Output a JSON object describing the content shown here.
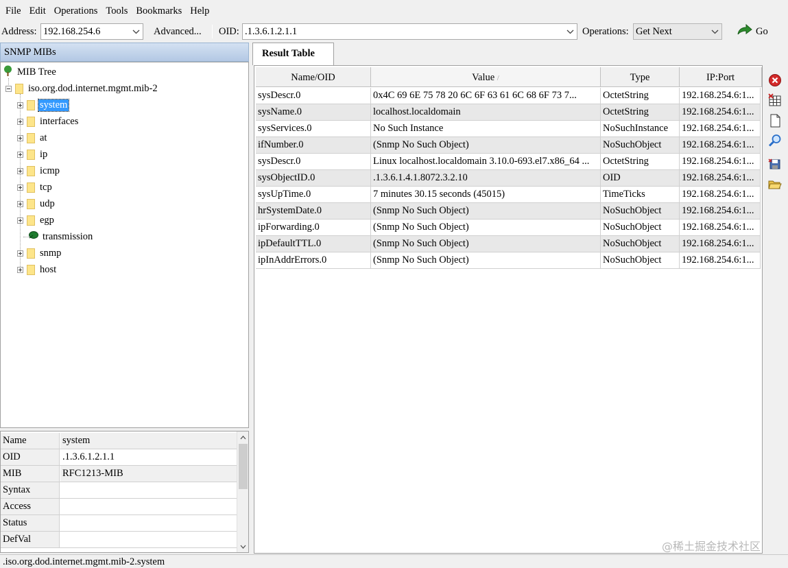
{
  "menu": [
    "File",
    "Edit",
    "Operations",
    "Tools",
    "Bookmarks",
    "Help"
  ],
  "toolbar": {
    "address_label": "Address:",
    "address_value": "192.168.254.6",
    "advanced_label": "Advanced...",
    "oid_label": "OID:",
    "oid_value": ".1.3.6.1.2.1.1",
    "operations_label": "Operations:",
    "operations_value": "Get Next",
    "go_label": "Go"
  },
  "left_panel": {
    "title": "SNMP MIBs",
    "tree": {
      "root": "MIB Tree",
      "branch": "iso.org.dod.internet.mgmt.mib-2",
      "children": [
        "system",
        "interfaces",
        "at",
        "ip",
        "icmp",
        "tcp",
        "udp",
        "egp",
        "transmission",
        "snmp",
        "host"
      ],
      "selected": "system"
    },
    "properties": [
      {
        "key": "Name",
        "value": "system"
      },
      {
        "key": "OID",
        "value": ".1.3.6.1.2.1.1"
      },
      {
        "key": "MIB",
        "value": "RFC1213-MIB"
      },
      {
        "key": "Syntax",
        "value": ""
      },
      {
        "key": "Access",
        "value": ""
      },
      {
        "key": "Status",
        "value": ""
      },
      {
        "key": "DefVal",
        "value": ""
      }
    ]
  },
  "result": {
    "tab_label": "Result Table",
    "columns": [
      "Name/OID",
      "Value",
      "Type",
      "IP:Port"
    ],
    "sort_indicator": "/",
    "rows": [
      {
        "name": "sysDescr.0",
        "value": "0x4C 69 6E 75 78 20 6C 6F 63 61 6C 68 6F 73 7...",
        "type": "OctetString",
        "ip": "192.168.254.6:1..."
      },
      {
        "name": "sysName.0",
        "value": "localhost.localdomain",
        "type": "OctetString",
        "ip": "192.168.254.6:1..."
      },
      {
        "name": "sysServices.0",
        "value": "No Such Instance",
        "type": "NoSuchInstance",
        "ip": "192.168.254.6:1..."
      },
      {
        "name": "ifNumber.0",
        "value": "(Snmp No Such Object)",
        "type": "NoSuchObject",
        "ip": "192.168.254.6:1..."
      },
      {
        "name": "sysDescr.0",
        "value": "Linux localhost.localdomain 3.10.0-693.el7.x86_64 ...",
        "type": "OctetString",
        "ip": "192.168.254.6:1..."
      },
      {
        "name": "sysObjectID.0",
        "value": ".1.3.6.1.4.1.8072.3.2.10",
        "type": "OID",
        "ip": "192.168.254.6:1..."
      },
      {
        "name": "sysUpTime.0",
        "value": "7 minutes 30.15 seconds (45015)",
        "type": "TimeTicks",
        "ip": "192.168.254.6:1..."
      },
      {
        "name": "hrSystemDate.0",
        "value": "(Snmp No Such Object)",
        "type": "NoSuchObject",
        "ip": "192.168.254.6:1..."
      },
      {
        "name": "ipForwarding.0",
        "value": "(Snmp No Such Object)",
        "type": "NoSuchObject",
        "ip": "192.168.254.6:1..."
      },
      {
        "name": "ipDefaultTTL.0",
        "value": "(Snmp No Such Object)",
        "type": "NoSuchObject",
        "ip": "192.168.254.6:1..."
      },
      {
        "name": "ipInAddrErrors.0",
        "value": "(Snmp No Such Object)",
        "type": "NoSuchObject",
        "ip": "192.168.254.6:1..."
      }
    ]
  },
  "status_bar": ".iso.org.dod.internet.mgmt.mib-2.system",
  "watermark": "@稀土掘金技术社区"
}
